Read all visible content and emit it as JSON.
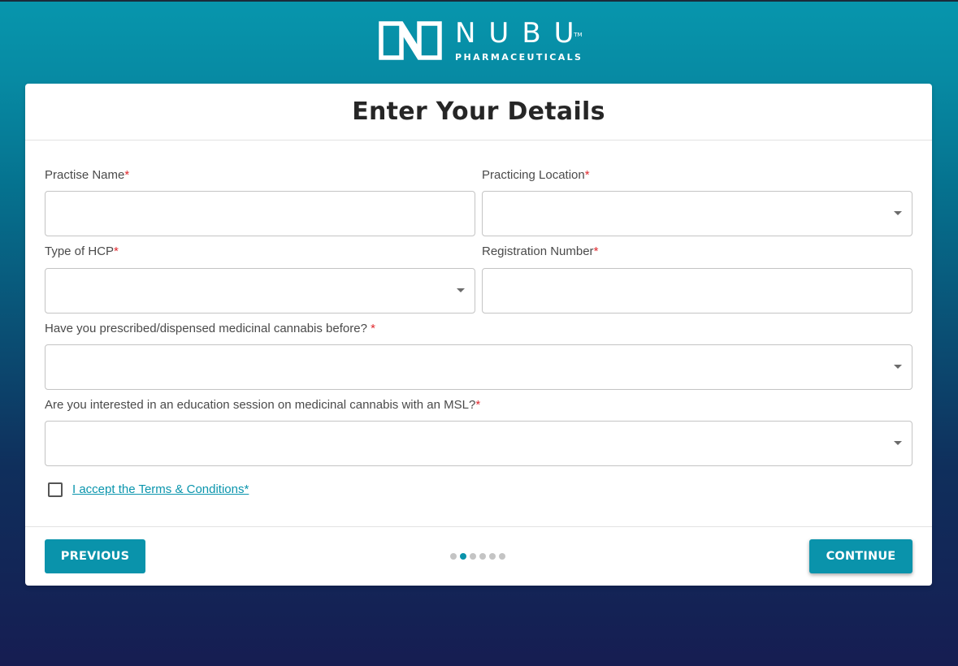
{
  "brand": {
    "name": "NUBU",
    "trademark": "TM",
    "subtitle": "PHARMACEUTICALS"
  },
  "form": {
    "title": "Enter Your Details",
    "fields": {
      "practise_name": {
        "label": "Practise Name",
        "required": "*",
        "value": ""
      },
      "practicing_location": {
        "label": "Practicing Location",
        "required": "*",
        "value": ""
      },
      "hcp_type": {
        "label": "Type of HCP",
        "required": "*",
        "value": ""
      },
      "registration_number": {
        "label": "Registration Number",
        "required": "*",
        "value": ""
      },
      "prescribed_before": {
        "label": "Have you prescribed/dispensed medicinal cannabis before? ",
        "required": "*",
        "value": ""
      },
      "education_session": {
        "label": "Are you interested in an education session on medicinal cannabis with an MSL?",
        "required": "*",
        "value": ""
      }
    },
    "terms": {
      "label": "I accept the Terms & Conditions",
      "required": "*",
      "checked": false
    }
  },
  "footer": {
    "previous_label": "PREVIOUS",
    "continue_label": "CONTINUE",
    "steps_total": 6,
    "current_step": 2
  },
  "colors": {
    "accent": "#0a93ab",
    "required": "#e0292e",
    "background_top": "#0796ad",
    "background_bottom": "#161d52"
  }
}
